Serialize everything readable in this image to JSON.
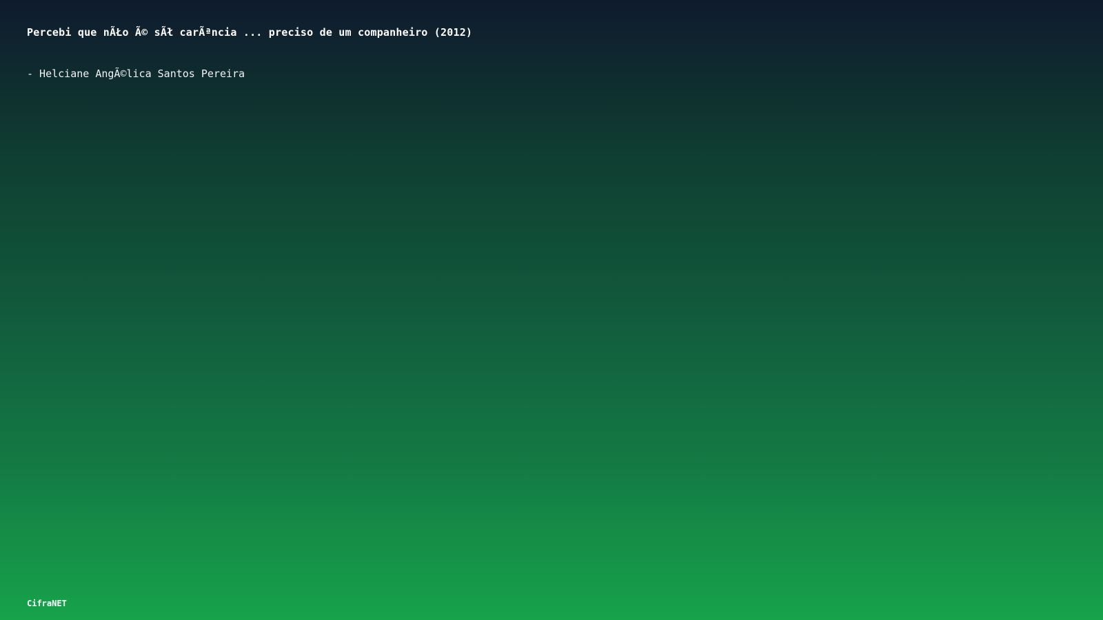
{
  "page": {
    "title": "Percebi que nÃŁo Ã© sÃł carÃªncia ... preciso de um companheiro (2012)",
    "author": "- Helciane AngÃ©lica Santos Pereira",
    "brand": "CifraNET"
  },
  "colors": {
    "background_top": "#0f1a2e",
    "background_bottom": "#16a34a",
    "text": "#ffffff"
  }
}
